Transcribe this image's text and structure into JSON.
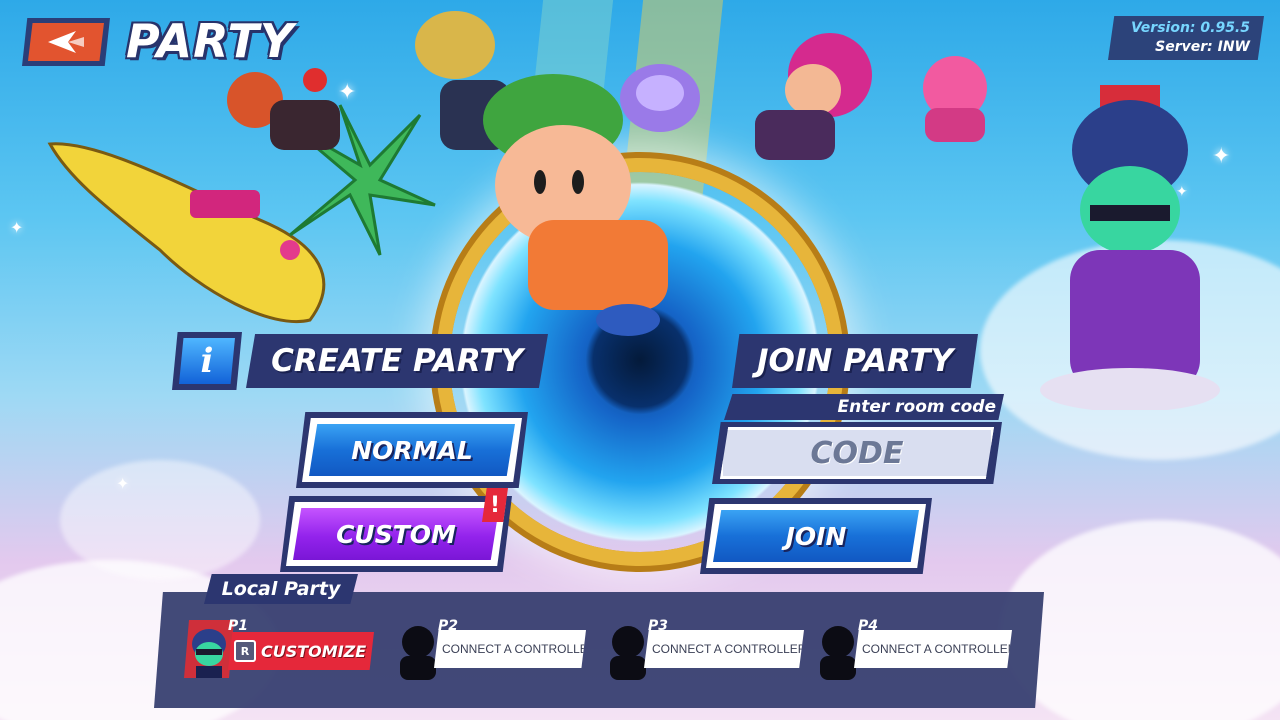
{
  "header": {
    "title": "PARTY",
    "back_icon": "back-arrow-icon",
    "version": "Version: 0.95.5",
    "server": "Server: INW"
  },
  "create": {
    "heading": "CREATE PARTY",
    "info_icon": "info-icon",
    "info_glyph": "i",
    "normal_label": "NORMAL",
    "custom_label": "CUSTOM",
    "custom_badge": "!"
  },
  "join": {
    "heading": "JOIN PARTY",
    "room_label": "Enter room code",
    "code_placeholder": "CODE",
    "join_label": "JOIN"
  },
  "local_party": {
    "label": "Local Party",
    "slots": [
      {
        "tag": "P1",
        "key": "R",
        "action": "CUSTOMIZE"
      },
      {
        "tag": "P2",
        "action": "CONNECT A CONTROLLER"
      },
      {
        "tag": "P3",
        "action": "CONNECT A CONTROLLER"
      },
      {
        "tag": "P4",
        "action": "CONNECT A CONTROLLER"
      }
    ]
  },
  "colors": {
    "accent_blue": "#1870d8",
    "accent_purple": "#9323ec",
    "accent_red": "#e5283a",
    "panel_navy": "#2c3670",
    "portal_gold": "#e7b53a"
  }
}
